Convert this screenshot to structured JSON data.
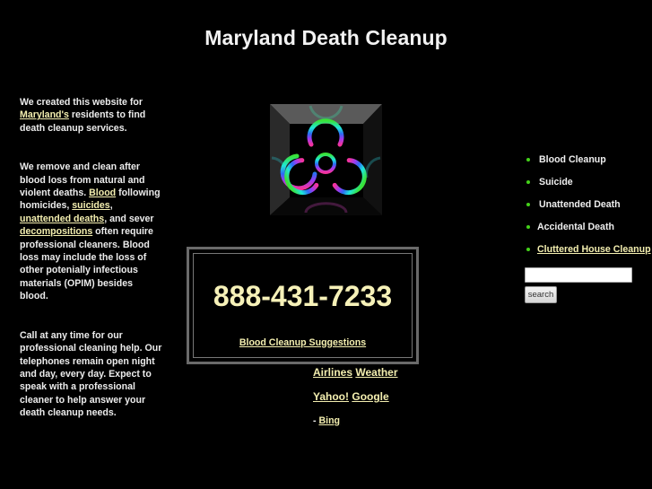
{
  "header": {
    "title": "Maryland Death Cleanup"
  },
  "intro": {
    "p1_prefix": "We created this website for ",
    "p1_link": "Maryland's",
    "p1_suffix": " residents to find death cleanup services.",
    "p2_text_a": "We remove and clean after blood loss from natural and violent deaths. ",
    "p2_link_blood": "Blood",
    "p2_text_b": " following homicides, ",
    "p2_link_suicides": "suicides",
    "p2_text_c": ", ",
    "p2_link_unattended": "unattended deaths",
    "p2_text_d": ", and sever ",
    "p2_link_decompositions": "decompositions",
    "p2_text_e": " often require professional cleaners. Blood loss may include the loss of other potenially infectious materials (OPIM) besides blood.",
    "p3_text": "Call at any time for our professional cleaning help. Our telephones remain open night and day, every day. Expect to speak with a professional cleaner to help answer your death cleanup needs."
  },
  "image": {
    "icon": "biohazard-icon",
    "colors": [
      "#39e23a",
      "#1ee7d9",
      "#2c6bf5",
      "#9a3cf0",
      "#f2339e"
    ]
  },
  "phone_box": {
    "phone": "888-431-7233",
    "link_label": "Blood Cleanup Suggestions"
  },
  "external_links": {
    "airlines": "Airlines",
    "weather": "Weather",
    "yahoo": "Yahoo!",
    "google": "Google",
    "bing_prefix": "- ",
    "bing": "Bing"
  },
  "nav": {
    "items": [
      {
        "label": "Blood Cleanup",
        "is_link": false
      },
      {
        "label": "Suicide",
        "is_link": false
      },
      {
        "label": "Unattended Death",
        "is_link": false
      },
      {
        "label": "Accidental Death",
        "is_link": false
      },
      {
        "label": "Cluttered House Cleanup",
        "is_link": true
      }
    ]
  },
  "search": {
    "value": "",
    "placeholder": "",
    "button_label": "search"
  },
  "colors": {
    "background": "#000000",
    "link": "#f4efb0",
    "phone": "#f6f1b8",
    "bullet": "#44d21a",
    "box_border": "#6a6a6a"
  }
}
